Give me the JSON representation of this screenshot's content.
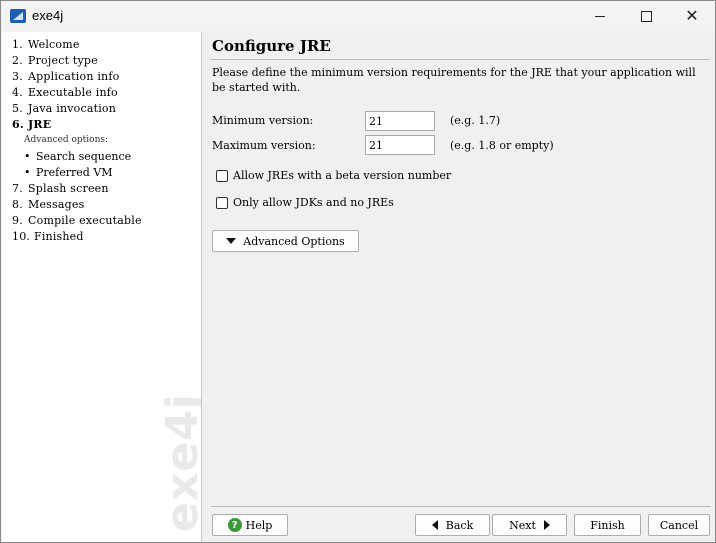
{
  "window": {
    "title": "exe4j"
  },
  "sidebar": {
    "watermark": "exe4j",
    "steps": [
      {
        "num": "1.",
        "label": "Welcome"
      },
      {
        "num": "2.",
        "label": "Project type"
      },
      {
        "num": "3.",
        "label": "Application info"
      },
      {
        "num": "4.",
        "label": "Executable info"
      },
      {
        "num": "5.",
        "label": "Java invocation"
      },
      {
        "num": "6.",
        "label": "JRE"
      },
      {
        "num": "7.",
        "label": "Splash screen"
      },
      {
        "num": "8.",
        "label": "Messages"
      },
      {
        "num": "9.",
        "label": "Compile executable"
      },
      {
        "num": "10.",
        "label": "Finished"
      }
    ],
    "advanced_label": "Advanced options:",
    "substeps": [
      {
        "bullet": "•",
        "label": "Search sequence"
      },
      {
        "bullet": "•",
        "label": "Preferred VM"
      }
    ]
  },
  "main": {
    "title": "Configure JRE",
    "description": "Please define the minimum version requirements for the JRE that your application will be started with.",
    "min_version": {
      "label": "Minimum version:",
      "value": "21",
      "hint": "(e.g. 1.7)"
    },
    "max_version": {
      "label": "Maximum version:",
      "value": "21",
      "hint": "(e.g. 1.8 or empty)"
    },
    "checkbox_beta": {
      "label": "Allow JREs with a beta version number",
      "checked": false
    },
    "checkbox_jdk": {
      "label": "Only allow JDKs and no JREs",
      "checked": false
    },
    "advanced_button": "Advanced Options"
  },
  "footer": {
    "help": "Help",
    "back": "Back",
    "next": "Next",
    "finish": "Finish",
    "cancel": "Cancel"
  },
  "icons": {
    "app": "exe4j-app-icon",
    "help": "help-icon",
    "help_color": "#3a9a3a"
  }
}
